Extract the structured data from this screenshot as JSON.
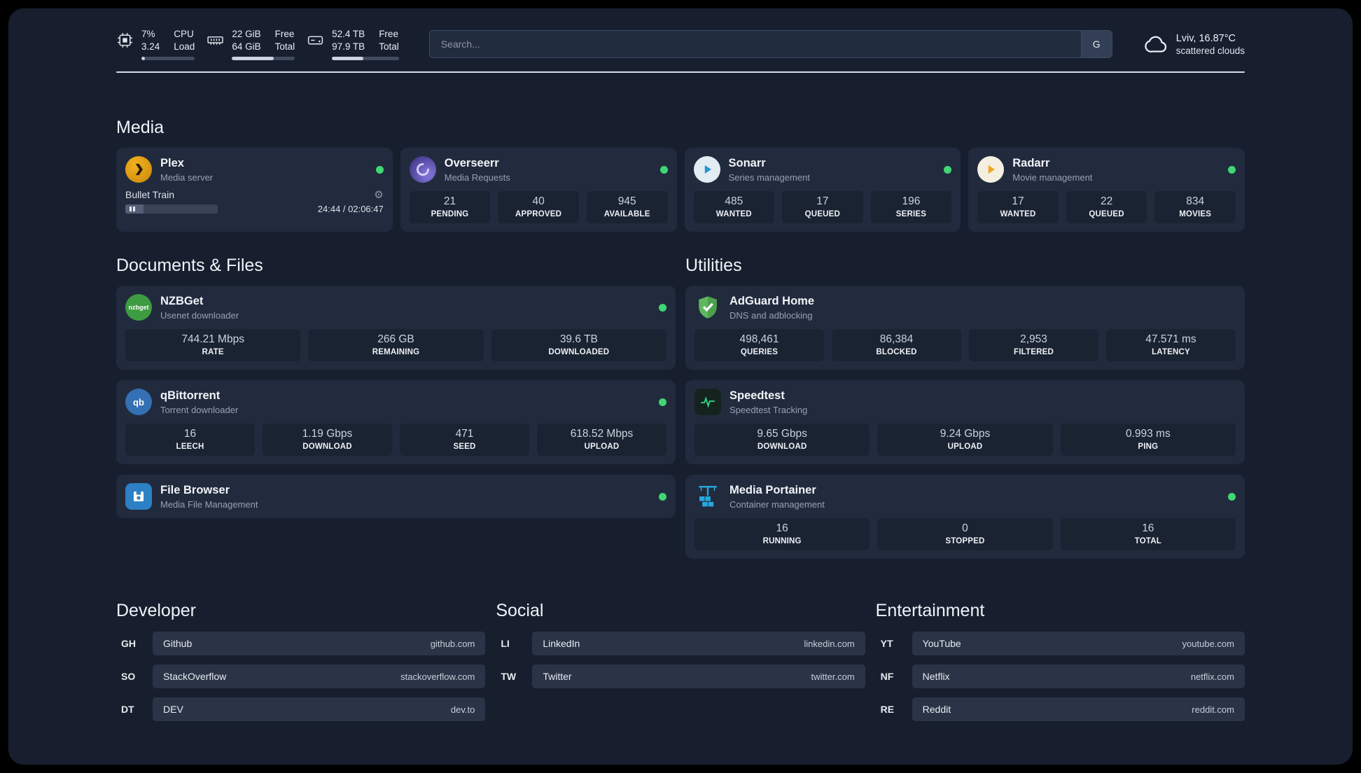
{
  "theme": {
    "panel_bg": "#171f2f",
    "card_bg": "#212b3d",
    "tile_bg": "#1a2332",
    "status_online_color": "#3fd673",
    "speedtest_line_color": "#31d183"
  },
  "topbar": {
    "cpu": {
      "icon": "cpu-icon",
      "values": [
        "7%",
        "3.24"
      ],
      "labels": [
        "CPU",
        "Load"
      ],
      "percent": 7
    },
    "memory": {
      "icon": "memory-icon",
      "values": [
        "22 GiB",
        "64 GiB"
      ],
      "labels": [
        "Free",
        "Total"
      ],
      "percent": 66
    },
    "disk": {
      "icon": "disk-icon",
      "values": [
        "52.4 TB",
        "97.9 TB"
      ],
      "labels": [
        "Free",
        "Total"
      ],
      "percent": 47
    },
    "search": {
      "placeholder": "Search...",
      "button_label": "G"
    },
    "weather": {
      "icon": "cloud-icon",
      "location": "Lviv, 16.87°C",
      "condition": "scattered clouds"
    }
  },
  "groups": {
    "media": {
      "title": "Media",
      "cards": [
        {
          "icon": "plex-icon",
          "name": "Plex",
          "description": "Media server",
          "status": "online",
          "player": {
            "track": "Bullet Train",
            "time": "24:44 / 02:06:47",
            "progress_percent": 20
          }
        },
        {
          "icon": "overseerr-icon",
          "name": "Overseerr",
          "description": "Media Requests",
          "status": "online",
          "stats": [
            {
              "value": "21",
              "label": "PENDING"
            },
            {
              "value": "40",
              "label": "APPROVED"
            },
            {
              "value": "945",
              "label": "AVAILABLE"
            }
          ]
        },
        {
          "icon": "sonarr-icon",
          "name": "Sonarr",
          "description": "Series management",
          "status": "online",
          "stats": [
            {
              "value": "485",
              "label": "WANTED"
            },
            {
              "value": "17",
              "label": "QUEUED"
            },
            {
              "value": "196",
              "label": "SERIES"
            }
          ]
        },
        {
          "icon": "radarr-icon",
          "name": "Radarr",
          "description": "Movie management",
          "status": "online",
          "stats": [
            {
              "value": "17",
              "label": "WANTED"
            },
            {
              "value": "22",
              "label": "QUEUED"
            },
            {
              "value": "834",
              "label": "MOVIES"
            }
          ]
        }
      ]
    },
    "documents": {
      "title": "Documents & Files",
      "cards": [
        {
          "icon": "nzbget-icon",
          "icon_text": "nzbget",
          "name": "NZBGet",
          "description": "Usenet downloader",
          "status": "online",
          "stats": [
            {
              "value": "744.21 Mbps",
              "label": "RATE"
            },
            {
              "value": "266 GB",
              "label": "REMAINING"
            },
            {
              "value": "39.6 TB",
              "label": "DOWNLOADED"
            }
          ]
        },
        {
          "icon": "qbittorrent-icon",
          "icon_text": "qb",
          "name": "qBittorrent",
          "description": "Torrent downloader",
          "status": "online",
          "stats": [
            {
              "value": "16",
              "label": "LEECH"
            },
            {
              "value": "1.19 Gbps",
              "label": "DOWNLOAD"
            },
            {
              "value": "471",
              "label": "SEED"
            },
            {
              "value": "618.52 Mbps",
              "label": "UPLOAD"
            }
          ]
        },
        {
          "icon": "filebrowser-icon",
          "name": "File Browser",
          "description": "Media File Management",
          "status": "online"
        }
      ]
    },
    "utilities": {
      "title": "Utilities",
      "cards": [
        {
          "icon": "adguard-icon",
          "name": "AdGuard Home",
          "description": "DNS and adblocking",
          "stats": [
            {
              "value": "498,461",
              "label": "QUERIES"
            },
            {
              "value": "86,384",
              "label": "BLOCKED"
            },
            {
              "value": "2,953",
              "label": "FILTERED"
            },
            {
              "value": "47.571 ms",
              "label": "LATENCY"
            }
          ]
        },
        {
          "icon": "speedtest-icon",
          "name": "Speedtest",
          "description": "Speedtest Tracking",
          "stats": [
            {
              "value": "9.65 Gbps",
              "label": "DOWNLOAD"
            },
            {
              "value": "9.24 Gbps",
              "label": "UPLOAD"
            },
            {
              "value": "0.993 ms",
              "label": "PING"
            }
          ]
        },
        {
          "icon": "portainer-icon",
          "name": "Media Portainer",
          "description": "Container management",
          "status": "online",
          "stats": [
            {
              "value": "16",
              "label": "RUNNING"
            },
            {
              "value": "0",
              "label": "STOPPED"
            },
            {
              "value": "16",
              "label": "TOTAL"
            }
          ]
        }
      ]
    }
  },
  "bookmarks": [
    {
      "title": "Developer",
      "items": [
        {
          "abbr": "GH",
          "name": "Github",
          "url": "github.com"
        },
        {
          "abbr": "SO",
          "name": "StackOverflow",
          "url": "stackoverflow.com"
        },
        {
          "abbr": "DT",
          "name": "DEV",
          "url": "dev.to"
        }
      ]
    },
    {
      "title": "Social",
      "items": [
        {
          "abbr": "LI",
          "name": "LinkedIn",
          "url": "linkedin.com"
        },
        {
          "abbr": "TW",
          "name": "Twitter",
          "url": "twitter.com"
        }
      ]
    },
    {
      "title": "Entertainment",
      "items": [
        {
          "abbr": "YT",
          "name": "YouTube",
          "url": "youtube.com"
        },
        {
          "abbr": "NF",
          "name": "Netflix",
          "url": "netflix.com"
        },
        {
          "abbr": "RE",
          "name": "Reddit",
          "url": "reddit.com"
        }
      ]
    }
  ]
}
